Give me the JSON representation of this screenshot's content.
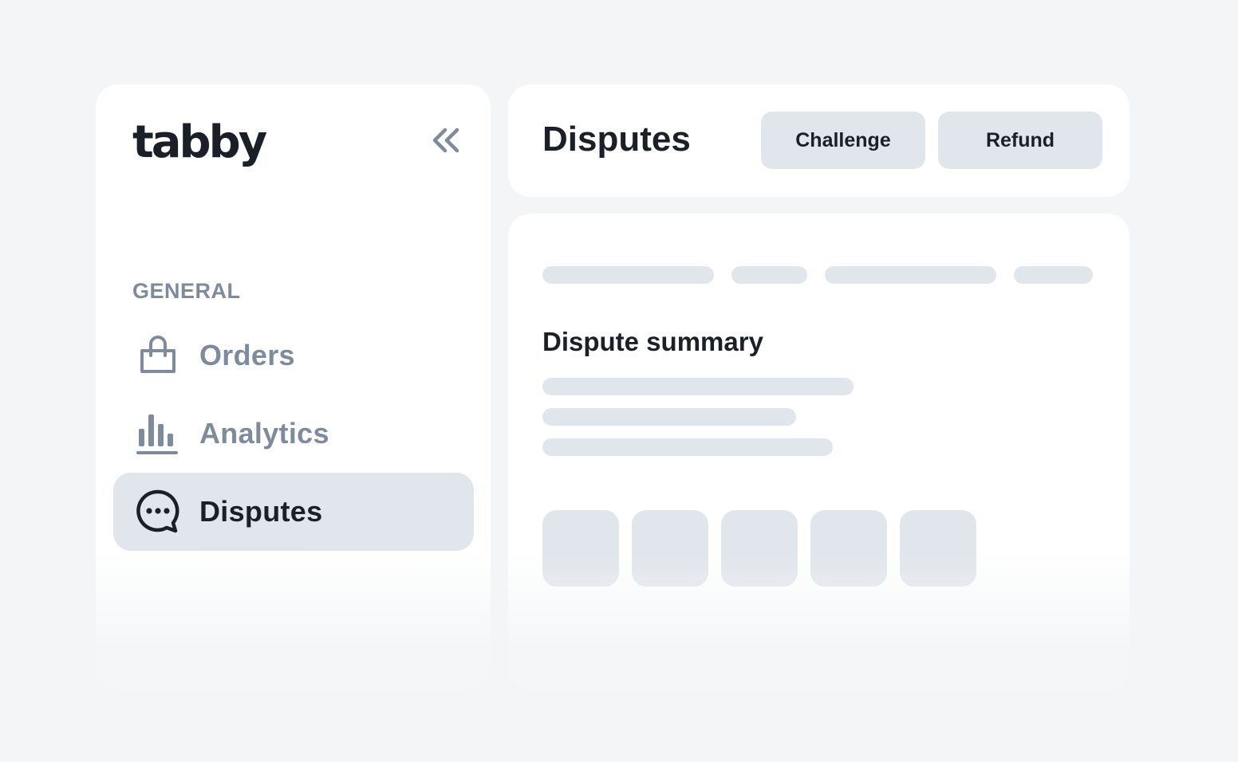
{
  "brand": {
    "logo_text": "tabby",
    "accent": "#1b2028",
    "muted": "#7d8b9c",
    "surface": "#e1e6ec"
  },
  "sidebar": {
    "collapse_icon": "double-chevron-left-icon",
    "section_label": "GENERAL",
    "items": [
      {
        "label": "Orders",
        "icon": "shopping-bag-icon",
        "active": false
      },
      {
        "label": "Analytics",
        "icon": "bar-chart-icon",
        "active": false
      },
      {
        "label": "Disputes",
        "icon": "chat-bubble-icon",
        "active": true
      }
    ]
  },
  "header": {
    "title": "Disputes",
    "challenge_label": "Challenge",
    "refund_label": "Refund"
  },
  "content": {
    "summary_title": "Dispute summary"
  }
}
